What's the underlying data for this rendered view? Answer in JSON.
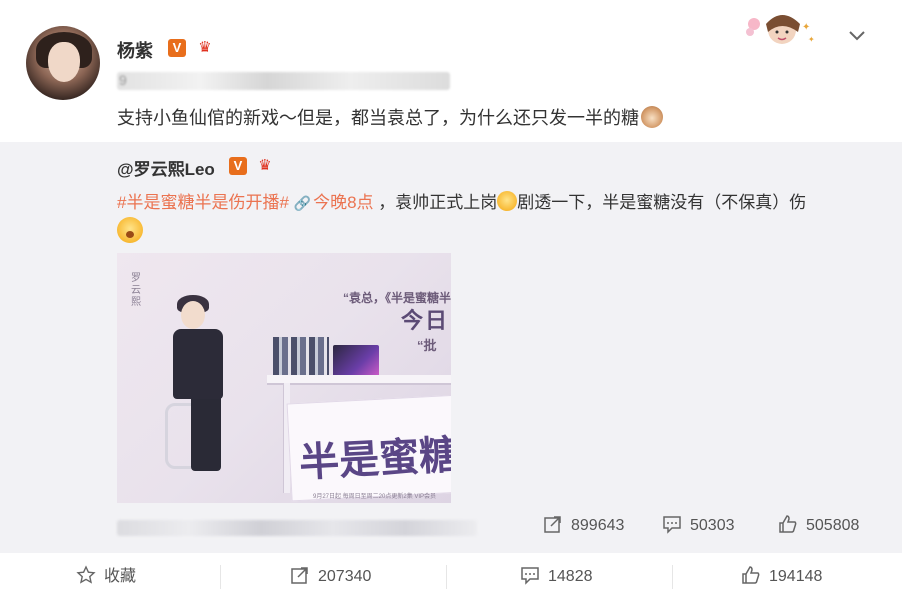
{
  "post": {
    "username": "杨紫",
    "verified_badge": "V",
    "level_badge_icon": "crown-icon",
    "meta_partial": "9",
    "text": "支持小鱼仙倌的新戏～但是，都当袁总了，为什么还只发一半的糖",
    "text_emoji": "cat-emoji"
  },
  "repost": {
    "author": "@罗云熙Leo",
    "verified_badge": "V",
    "hashtag": "#半是蜜糖半是伤开播#",
    "link_label": "今晚8点",
    "text_part1": "，袁帅正式上岗",
    "text_part2": "剧透一下，半是蜜糖没有（不保真）伤",
    "poster": {
      "side_text": "罗云熙",
      "quote_text": "“袁总，《半是蜜糖半是",
      "headline": "今日",
      "approve": "“批",
      "title": "半是蜜糖 半",
      "date_line": "9月27日起 每周日至周二20点更新2集 VIP会员"
    },
    "stats": {
      "repost": "899643",
      "comment": "50303",
      "like": "505808"
    }
  },
  "actions": {
    "favorite": "收藏",
    "repost": "207340",
    "comment": "14828",
    "like": "194148"
  },
  "colors": {
    "accent": "#eb7350",
    "repost_bg": "#f2f2f5",
    "badge_orange": "#e86e1c"
  }
}
